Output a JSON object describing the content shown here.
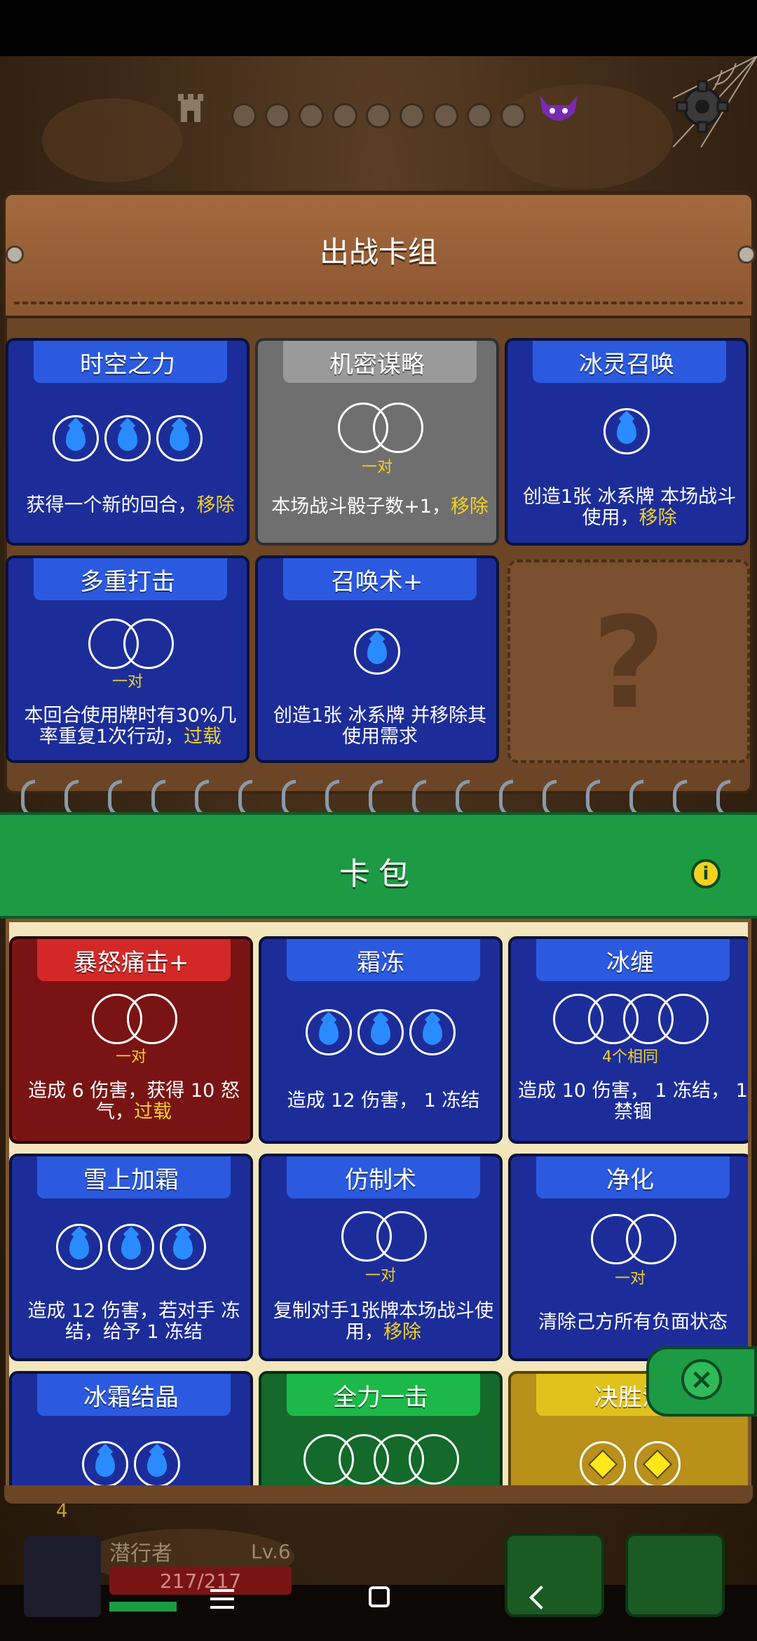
{
  "game": {
    "deck_title": "出战卡组",
    "bag_title": "卡包",
    "player": {
      "name": "潜行者",
      "level": "Lv.6",
      "hp": "217/217",
      "coins": "4"
    }
  },
  "deck_cards": [
    {
      "name": "时空之力",
      "desc": "获得一个新的回合，",
      "tag": "移除"
    },
    {
      "name": "机密谋略",
      "pair_label": "一对",
      "desc": "本场战斗骰子数+1，",
      "tag": "移除"
    },
    {
      "name": "冰灵召唤",
      "desc": "创造1张 冰系牌 本场战斗使用，",
      "tag": "移除"
    },
    {
      "name": "多重打击",
      "pair_label": "一对",
      "desc": "本回合使用牌时有30%几率重复1次行动，",
      "tag": "过载"
    },
    {
      "name": "召唤术+",
      "desc": "创造1张 冰系牌 并移除其使用需求"
    }
  ],
  "mystery_slot": "?",
  "bag_cards": [
    {
      "name": "暴怒痛击+",
      "pair_label": "一对",
      "desc": "造成 6 伤害，获得 10 怒气，",
      "tag": "过载"
    },
    {
      "name": "霜冻",
      "desc": "造成 12 伤害， 1 冻结"
    },
    {
      "name": "冰缠",
      "pair_label": "4个相同",
      "desc": "造成 10 伤害， 1 冻结， 1 禁锢"
    },
    {
      "name": "雪上加霜",
      "desc": "造成 12 伤害，若对手 冻结，给予 1 冻结"
    },
    {
      "name": "仿制术",
      "pair_label": "一对",
      "desc": "复制对手1张牌本场战斗使用，",
      "tag": "移除"
    },
    {
      "name": "净化",
      "pair_label": "一对",
      "desc": "清除己方所有负面状态"
    },
    {
      "name": "冰霜结晶"
    },
    {
      "name": "全力一击"
    },
    {
      "name": "决胜治"
    }
  ],
  "icons": {
    "info": "i",
    "close": "×"
  },
  "colors": {
    "card_blue": "#1c2d9a",
    "card_red": "#7a1414",
    "card_gray": "#6f6f6f",
    "card_green": "#136a2b",
    "card_gold": "#b8901a",
    "highlight": "#f2d21f"
  }
}
